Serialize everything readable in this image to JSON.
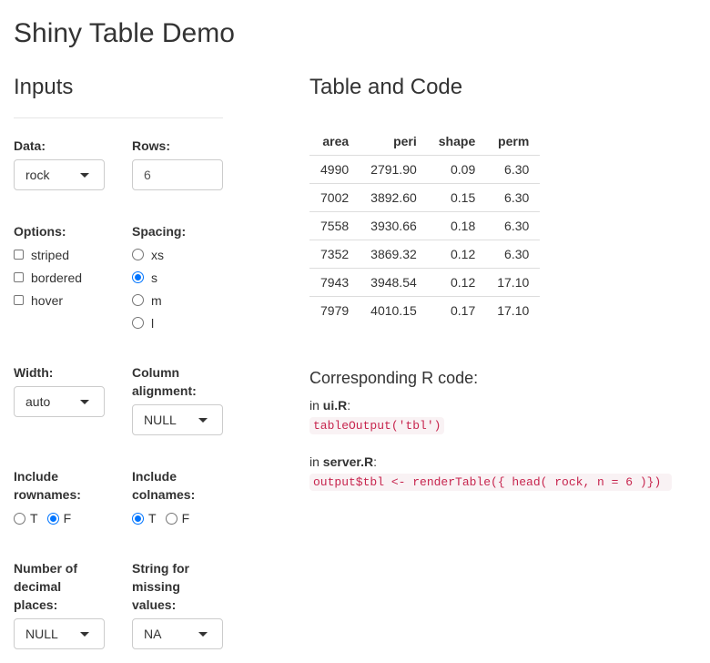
{
  "app": {
    "title": "Shiny Table Demo"
  },
  "inputs": {
    "heading": "Inputs",
    "data": {
      "label": "Data:",
      "value": "rock"
    },
    "rows": {
      "label": "Rows:",
      "value": "6"
    },
    "options": {
      "label": "Options:",
      "items": [
        "striped",
        "bordered",
        "hover"
      ]
    },
    "spacing": {
      "label": "Spacing:",
      "items": [
        "xs",
        "s",
        "m",
        "l"
      ],
      "selected": "s"
    },
    "width": {
      "label": "Width:",
      "value": "auto"
    },
    "column_alignment": {
      "label_line1": "Column",
      "label_line2": "alignment:",
      "value": "NULL"
    },
    "include_rownames": {
      "label_line1": "Include",
      "label_line2": "rownames:",
      "opt_t": "T",
      "opt_f": "F",
      "selected": "F"
    },
    "include_colnames": {
      "label_line1": "Include",
      "label_line2": "colnames:",
      "opt_t": "T",
      "opt_f": "F",
      "selected": "T"
    },
    "decimal_places": {
      "label_line1": "Number of",
      "label_line2": "decimal",
      "label_line3": "places:",
      "value": "NULL"
    },
    "missing_values": {
      "label_line1": "String for",
      "label_line2": "missing",
      "label_line3": "values:",
      "value": "NA"
    }
  },
  "output": {
    "heading": "Table and Code",
    "table": {
      "columns": [
        "area",
        "peri",
        "shape",
        "perm"
      ],
      "rows": [
        [
          "4990",
          "2791.90",
          "0.09",
          "6.30"
        ],
        [
          "7002",
          "3892.60",
          "0.15",
          "6.30"
        ],
        [
          "7558",
          "3930.66",
          "0.18",
          "6.30"
        ],
        [
          "7352",
          "3869.32",
          "0.12",
          "6.30"
        ],
        [
          "7943",
          "3948.54",
          "0.12",
          "17.10"
        ],
        [
          "7979",
          "4010.15",
          "0.17",
          "17.10"
        ]
      ]
    },
    "code_heading": "Corresponding R code:",
    "ui_prefix": "in ",
    "ui_file": "ui.R",
    "ui_suffix": ":",
    "ui_code": "tableOutput('tbl')",
    "server_prefix": "in ",
    "server_file": "server.R",
    "server_suffix": ":",
    "server_code": "output$tbl <- renderTable({ head( rock, n = 6 )}) "
  }
}
